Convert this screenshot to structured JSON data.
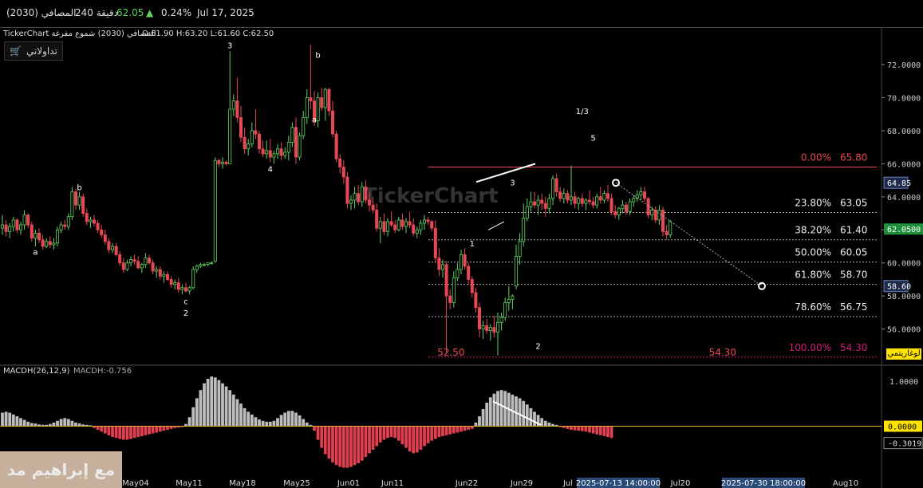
{
  "header": {
    "date": "Jul 17, 2025",
    "change_pct": "0.24%",
    "price": "62.05",
    "interval": "240 دقيقة",
    "symbol": "(2030)  المصافي"
  },
  "chart_header": {
    "title": "TickerChart المصافي (2030) شموع مفرغة",
    "ohlc": "O:61.90  H:63.20  L:61.60  C:62.50"
  },
  "portfolio_label": "تداولاتي",
  "log_label": "لوغاريتمي",
  "watermark_text": "مع إبراهيم مد",
  "colors": {
    "up": "#5fd35f",
    "down": "#e84855",
    "fib_top": "#e84855",
    "fib_bottom": "#d41a7a",
    "macd_pos": "#bdbdbd",
    "macd_neg": "#e04050",
    "zero_line": "#e0b030"
  },
  "chart_data": {
    "type": "candlestick",
    "y_axis_ticks": [
      "72.0000",
      "70.0000",
      "68.0000",
      "66.0000",
      "64.0000",
      "62.0000",
      "60.0000",
      "58.0000",
      "56.0000"
    ],
    "ylim": [
      54.1,
      73.4
    ],
    "x_axis_ticks": [
      "May04",
      "May11",
      "May18",
      "May25",
      "Jun01",
      "Jun11",
      "Jun22",
      "Jun29",
      "Jul",
      "Jul20",
      "Aug10"
    ],
    "x_axis_highlight": [
      "2025-07-13 14:00:00",
      "2025-07-30 18:00:00"
    ],
    "price_badges": [
      {
        "label": "64.85",
        "value": 64.85
      },
      {
        "label": "62.0500",
        "value": 62.05
      },
      {
        "label": "58.60",
        "value": 58.6
      }
    ],
    "fibonacci": [
      {
        "pct": "0.00%",
        "price": "65.80",
        "value": 65.8
      },
      {
        "pct": "23.80%",
        "price": "63.05",
        "value": 63.05
      },
      {
        "pct": "38.20%",
        "price": "61.40",
        "value": 61.4
      },
      {
        "pct": "50.00%",
        "price": "60.05",
        "value": 60.05
      },
      {
        "pct": "61.80%",
        "price": "58.70",
        "value": 58.7
      },
      {
        "pct": "78.60%",
        "price": "56.75",
        "value": 56.75
      },
      {
        "pct": "100.00%",
        "price": "54.30",
        "value": 54.3
      }
    ],
    "low_labels": [
      {
        "text": "52.50",
        "value": 54.4,
        "i": 122
      },
      {
        "text": "54.30",
        "value": 54.4,
        "i": 196
      }
    ],
    "wave_labels": [
      {
        "text": "3",
        "i": 62,
        "value": 73.0
      },
      {
        "text": "b",
        "i": 86,
        "value": 72.4
      },
      {
        "text": "a",
        "i": 85,
        "value": 68.5
      },
      {
        "text": "4",
        "i": 73,
        "value": 65.5
      },
      {
        "text": "b",
        "i": 21,
        "value": 64.4
      },
      {
        "text": "a",
        "i": 9,
        "value": 60.5
      },
      {
        "text": "c",
        "i": 50,
        "value": 57.5
      },
      {
        "text": "2",
        "i": 50,
        "value": 56.8
      },
      {
        "text": "1",
        "i": 128,
        "value": 61.0
      },
      {
        "text": "2",
        "i": 146,
        "value": 54.8
      },
      {
        "text": "3",
        "i": 139,
        "value": 64.7
      },
      {
        "text": "1/3",
        "i": 158,
        "value": 69.0
      },
      {
        "text": "5",
        "i": 161,
        "value": 67.4
      }
    ],
    "candles": [
      [
        62.1,
        62.9,
        61.7,
        62.3
      ],
      [
        62.3,
        62.6,
        61.6,
        61.9
      ],
      [
        61.9,
        62.4,
        61.5,
        62.2
      ],
      [
        62.2,
        62.8,
        61.9,
        62.6
      ],
      [
        62.6,
        62.7,
        61.8,
        62.0
      ],
      [
        62.0,
        62.5,
        61.7,
        62.3
      ],
      [
        62.3,
        63.2,
        62.0,
        62.9
      ],
      [
        62.9,
        63.0,
        62.1,
        62.3
      ],
      [
        62.3,
        62.5,
        61.3,
        61.5
      ],
      [
        61.5,
        62.0,
        61.0,
        61.8
      ],
      [
        61.8,
        62.1,
        61.2,
        61.4
      ],
      [
        61.4,
        61.7,
        60.8,
        61.0
      ],
      [
        61.0,
        61.5,
        60.9,
        61.3
      ],
      [
        61.3,
        61.6,
        60.9,
        61.1
      ],
      [
        61.1,
        61.5,
        60.8,
        61.2
      ],
      [
        61.2,
        62.2,
        61.0,
        62.0
      ],
      [
        62.0,
        62.5,
        61.8,
        62.3
      ],
      [
        62.3,
        62.6,
        62.0,
        62.2
      ],
      [
        62.2,
        63.0,
        62.0,
        62.8
      ],
      [
        62.8,
        64.6,
        62.6,
        64.3
      ],
      [
        64.3,
        64.5,
        63.2,
        63.5
      ],
      [
        63.5,
        64.3,
        63.2,
        64.0
      ],
      [
        64.0,
        64.2,
        62.8,
        63.0
      ],
      [
        63.0,
        63.3,
        62.3,
        62.5
      ],
      [
        62.5,
        62.8,
        62.1,
        62.6
      ],
      [
        62.6,
        62.9,
        62.2,
        62.4
      ],
      [
        62.4,
        62.6,
        61.8,
        62.0
      ],
      [
        62.0,
        62.3,
        61.5,
        61.7
      ],
      [
        61.7,
        62.0,
        61.1,
        61.3
      ],
      [
        61.3,
        61.5,
        60.6,
        60.8
      ],
      [
        60.8,
        61.2,
        60.6,
        61.0
      ],
      [
        61.0,
        61.2,
        60.4,
        60.5
      ],
      [
        60.5,
        60.7,
        59.8,
        60.0
      ],
      [
        60.0,
        60.3,
        59.4,
        59.6
      ],
      [
        59.6,
        60.2,
        59.5,
        60.0
      ],
      [
        60.0,
        60.4,
        59.8,
        60.2
      ],
      [
        60.2,
        60.5,
        59.9,
        60.1
      ],
      [
        60.1,
        60.4,
        59.6,
        59.7
      ],
      [
        59.7,
        60.0,
        59.4,
        59.9
      ],
      [
        59.9,
        60.6,
        59.7,
        60.3
      ],
      [
        60.3,
        60.5,
        59.9,
        60.0
      ],
      [
        60.0,
        60.2,
        59.3,
        59.5
      ],
      [
        59.5,
        59.8,
        59.1,
        59.6
      ],
      [
        59.6,
        59.8,
        59.0,
        59.2
      ],
      [
        59.2,
        59.5,
        58.8,
        59.3
      ],
      [
        59.3,
        59.5,
        58.9,
        59.0
      ],
      [
        59.0,
        59.2,
        58.5,
        58.7
      ],
      [
        58.7,
        59.0,
        58.4,
        58.8
      ],
      [
        58.8,
        59.1,
        58.2,
        58.4
      ],
      [
        58.4,
        58.7,
        58.1,
        58.5
      ],
      [
        58.5,
        58.8,
        58.2,
        58.3
      ],
      [
        58.3,
        58.6,
        58.1,
        58.5
      ],
      [
        58.5,
        59.8,
        58.4,
        59.6
      ],
      [
        59.6,
        59.9,
        59.4,
        59.8
      ],
      [
        59.8,
        60.0,
        59.7,
        59.9
      ],
      [
        59.9,
        60.0,
        59.8,
        59.9
      ],
      [
        59.9,
        60.0,
        59.8,
        60.0
      ],
      [
        60.0,
        60.1,
        59.9,
        60.0
      ],
      [
        60.1,
        66.4,
        60.0,
        66.2
      ],
      [
        66.2,
        66.3,
        65.8,
        66.0
      ],
      [
        66.0,
        66.4,
        65.7,
        66.1
      ],
      [
        66.1,
        66.2,
        65.9,
        66.0
      ],
      [
        66.0,
        72.8,
        66.0,
        69.3
      ],
      [
        69.3,
        70.2,
        68.9,
        69.8
      ],
      [
        69.8,
        71.2,
        68.5,
        68.8
      ],
      [
        68.8,
        69.5,
        67.3,
        67.6
      ],
      [
        67.6,
        68.2,
        66.6,
        66.9
      ],
      [
        66.9,
        67.5,
        66.5,
        67.2
      ],
      [
        67.2,
        68.5,
        67.0,
        68.0
      ],
      [
        68.0,
        69.3,
        67.5,
        67.8
      ],
      [
        67.8,
        68.0,
        66.6,
        66.9
      ],
      [
        66.9,
        67.4,
        66.4,
        66.6
      ],
      [
        66.6,
        67.4,
        66.3,
        66.8
      ],
      [
        66.8,
        67.5,
        66.1,
        66.4
      ],
      [
        66.4,
        66.8,
        66.0,
        66.6
      ],
      [
        66.6,
        67.2,
        66.3,
        66.9
      ],
      [
        66.9,
        67.3,
        66.2,
        66.5
      ],
      [
        66.5,
        67.0,
        66.3,
        66.7
      ],
      [
        66.7,
        67.7,
        66.2,
        67.3
      ],
      [
        67.3,
        68.5,
        67.0,
        68.2
      ],
      [
        68.2,
        68.8,
        66.0,
        66.4
      ],
      [
        66.4,
        67.9,
        66.2,
        67.7
      ],
      [
        67.7,
        69.2,
        67.5,
        68.8
      ],
      [
        68.8,
        70.5,
        68.4,
        70.0
      ],
      [
        70.0,
        73.2,
        69.3,
        69.8
      ],
      [
        69.8,
        70.4,
        68.3,
        68.6
      ],
      [
        68.6,
        70.3,
        68.2,
        70.0
      ],
      [
        70.0,
        70.6,
        69.2,
        69.4
      ],
      [
        69.4,
        70.6,
        68.6,
        70.5
      ],
      [
        70.5,
        70.6,
        68.9,
        69.2
      ],
      [
        69.2,
        69.8,
        67.6,
        67.8
      ],
      [
        67.8,
        68.0,
        66.1,
        66.3
      ],
      [
        66.3,
        66.6,
        65.4,
        65.8
      ],
      [
        65.8,
        66.2,
        64.8,
        65.2
      ],
      [
        65.2,
        65.5,
        63.3,
        63.6
      ],
      [
        63.6,
        64.1,
        63.2,
        63.8
      ],
      [
        63.8,
        64.6,
        63.3,
        64.2
      ],
      [
        64.2,
        64.7,
        63.5,
        63.7
      ],
      [
        63.7,
        64.9,
        63.4,
        64.6
      ],
      [
        64.6,
        65.0,
        63.6,
        63.8
      ],
      [
        63.8,
        64.3,
        63.1,
        63.5
      ],
      [
        63.5,
        64.0,
        63.0,
        63.2
      ],
      [
        63.2,
        63.6,
        61.9,
        62.1
      ],
      [
        62.1,
        62.8,
        61.2,
        62.5
      ],
      [
        62.5,
        63.0,
        61.7,
        61.9
      ],
      [
        61.9,
        62.7,
        61.6,
        62.5
      ],
      [
        62.5,
        63.1,
        62.2,
        62.3
      ],
      [
        62.3,
        62.6,
        61.8,
        62.0
      ],
      [
        62.0,
        62.8,
        61.9,
        62.6
      ],
      [
        62.6,
        63.0,
        62.0,
        62.2
      ],
      [
        62.2,
        62.7,
        61.8,
        62.5
      ],
      [
        62.5,
        63.1,
        62.1,
        62.3
      ],
      [
        62.3,
        62.7,
        61.6,
        61.8
      ],
      [
        61.8,
        62.2,
        61.5,
        62.0
      ],
      [
        62.0,
        62.6,
        61.7,
        62.4
      ],
      [
        62.4,
        62.9,
        62.0,
        62.6
      ],
      [
        62.6,
        62.8,
        62.3,
        62.5
      ],
      [
        62.5,
        62.6,
        61.9,
        62.1
      ],
      [
        62.1,
        62.6,
        60.0,
        60.3
      ],
      [
        60.3,
        60.9,
        59.2,
        59.6
      ],
      [
        59.6,
        60.2,
        59.1,
        59.9
      ],
      [
        59.9,
        60.1,
        54.5,
        58.0
      ],
      [
        58.0,
        58.4,
        57.2,
        57.6
      ],
      [
        57.6,
        59.5,
        57.3,
        59.1
      ],
      [
        59.1,
        60.0,
        58.9,
        59.6
      ],
      [
        59.6,
        60.8,
        59.3,
        60.5
      ],
      [
        60.5,
        60.9,
        59.6,
        59.8
      ],
      [
        59.8,
        60.0,
        58.7,
        59.0
      ],
      [
        59.0,
        59.2,
        57.9,
        58.2
      ],
      [
        58.2,
        58.5,
        57.0,
        57.3
      ],
      [
        57.3,
        57.6,
        55.5,
        56.0
      ],
      [
        56.0,
        56.5,
        55.4,
        56.2
      ],
      [
        56.2,
        56.6,
        55.7,
        55.9
      ],
      [
        55.9,
        56.3,
        55.3,
        56.1
      ],
      [
        56.1,
        56.8,
        55.5,
        55.8
      ],
      [
        55.8,
        57.0,
        54.4,
        56.4
      ],
      [
        56.4,
        57.0,
        55.9,
        56.7
      ],
      [
        56.7,
        57.9,
        56.5,
        57.6
      ],
      [
        57.6,
        58.6,
        57.1,
        57.8
      ],
      [
        57.8,
        58.1,
        57.2,
        58.0
      ],
      [
        58.6,
        61.1,
        58.4,
        60.4
      ],
      [
        60.4,
        61.8,
        59.9,
        61.3
      ],
      [
        61.3,
        63.6,
        61.0,
        62.7
      ],
      [
        62.7,
        63.9,
        62.5,
        63.4
      ],
      [
        63.4,
        64.3,
        63.1,
        63.7
      ],
      [
        63.7,
        64.3,
        63.3,
        63.5
      ],
      [
        63.5,
        64.1,
        62.9,
        63.8
      ],
      [
        63.8,
        64.2,
        63.2,
        63.6
      ],
      [
        63.6,
        64.0,
        62.8,
        63.3
      ],
      [
        63.3,
        64.2,
        63.0,
        63.9
      ],
      [
        63.9,
        65.3,
        63.5,
        65.1
      ],
      [
        65.1,
        65.4,
        64.0,
        64.3
      ],
      [
        64.3,
        64.6,
        63.7,
        63.9
      ],
      [
        63.9,
        64.5,
        63.6,
        64.2
      ],
      [
        64.2,
        64.4,
        63.6,
        63.8
      ],
      [
        63.8,
        65.9,
        63.5,
        64.0
      ],
      [
        64.0,
        64.3,
        63.3,
        63.6
      ],
      [
        63.6,
        64.0,
        63.2,
        63.9
      ],
      [
        63.9,
        64.2,
        63.4,
        63.6
      ],
      [
        63.6,
        63.9,
        63.2,
        63.8
      ],
      [
        63.8,
        64.4,
        63.5,
        63.7
      ],
      [
        63.7,
        64.0,
        63.3,
        63.5
      ],
      [
        63.5,
        64.2,
        63.3,
        64.0
      ],
      [
        64.0,
        64.6,
        63.6,
        63.8
      ],
      [
        63.8,
        64.4,
        63.6,
        64.2
      ],
      [
        64.2,
        64.7,
        63.7,
        63.9
      ],
      [
        63.9,
        64.2,
        62.9,
        63.1
      ],
      [
        63.1,
        63.5,
        62.7,
        62.9
      ],
      [
        62.9,
        63.4,
        62.6,
        63.3
      ],
      [
        63.3,
        63.8,
        63.0,
        63.5
      ],
      [
        63.5,
        63.7,
        62.9,
        63.1
      ],
      [
        63.1,
        63.9,
        62.9,
        63.7
      ],
      [
        63.7,
        64.1,
        63.4,
        63.9
      ],
      [
        63.9,
        64.4,
        63.7,
        64.1
      ],
      [
        64.1,
        64.6,
        63.8,
        64.3
      ],
      [
        64.3,
        64.6,
        63.7,
        63.9
      ],
      [
        63.9,
        64.0,
        62.7,
        62.9
      ],
      [
        62.9,
        63.4,
        62.6,
        63.2
      ],
      [
        63.2,
        63.4,
        62.4,
        62.6
      ],
      [
        62.6,
        63.5,
        62.3,
        63.2
      ],
      [
        63.2,
        63.4,
        61.6,
        61.9
      ],
      [
        61.9,
        62.3,
        61.4,
        61.7
      ],
      [
        61.7,
        62.6,
        61.5,
        62.5
      ]
    ],
    "macd": {
      "label": "MACDH(26,12,9)",
      "value_label": "MACDH:-0.756",
      "ticks": [
        "1.0000",
        "0.0000"
      ],
      "ylim": [
        -1.05,
        1.28
      ],
      "badges": [
        {
          "label": "0.0000",
          "value": 0.0
        },
        {
          "label": "-0.3019",
          "value": -0.3019
        }
      ],
      "values": [
        0.3,
        0.32,
        0.3,
        0.26,
        0.22,
        0.18,
        0.14,
        0.1,
        0.07,
        0.06,
        0.04,
        0.03,
        0.03,
        0.05,
        0.08,
        0.12,
        0.16,
        0.18,
        0.16,
        0.12,
        0.08,
        0.06,
        0.04,
        0.03,
        0.02,
        -0.04,
        -0.08,
        -0.12,
        -0.16,
        -0.2,
        -0.24,
        -0.26,
        -0.28,
        -0.3,
        -0.3,
        -0.28,
        -0.26,
        -0.24,
        -0.22,
        -0.2,
        -0.18,
        -0.16,
        -0.14,
        -0.12,
        -0.1,
        -0.08,
        -0.06,
        -0.04,
        -0.03,
        -0.02,
        0.05,
        0.2,
        0.42,
        0.62,
        0.8,
        0.95,
        1.05,
        1.1,
        1.08,
        1.02,
        0.95,
        0.88,
        0.8,
        0.7,
        0.6,
        0.5,
        0.4,
        0.32,
        0.26,
        0.2,
        0.15,
        0.12,
        0.1,
        0.1,
        0.12,
        0.18,
        0.25,
        0.3,
        0.34,
        0.34,
        0.3,
        0.24,
        0.16,
        0.08,
        0.03,
        -0.1,
        -0.3,
        -0.48,
        -0.62,
        -0.72,
        -0.8,
        -0.86,
        -0.9,
        -0.92,
        -0.92,
        -0.9,
        -0.86,
        -0.82,
        -0.76,
        -0.68,
        -0.6,
        -0.52,
        -0.44,
        -0.36,
        -0.3,
        -0.26,
        -0.24,
        -0.26,
        -0.32,
        -0.4,
        -0.48,
        -0.56,
        -0.6,
        -0.58,
        -0.52,
        -0.44,
        -0.38,
        -0.32,
        -0.28,
        -0.24,
        -0.22,
        -0.2,
        -0.18,
        -0.16,
        -0.14,
        -0.12,
        -0.1,
        -0.08,
        -0.06,
        0.08,
        0.22,
        0.38,
        0.52,
        0.64,
        0.72,
        0.78,
        0.8,
        0.78,
        0.74,
        0.7,
        0.66,
        0.62,
        0.56,
        0.48,
        0.4,
        0.32,
        0.25,
        0.18,
        0.12,
        0.08,
        0.05,
        0.03,
        -0.02,
        -0.04,
        -0.06,
        -0.08,
        -0.09,
        -0.1,
        -0.11,
        -0.12,
        -0.14,
        -0.16,
        -0.18,
        -0.2,
        -0.22,
        -0.24,
        -0.26
      ]
    }
  }
}
